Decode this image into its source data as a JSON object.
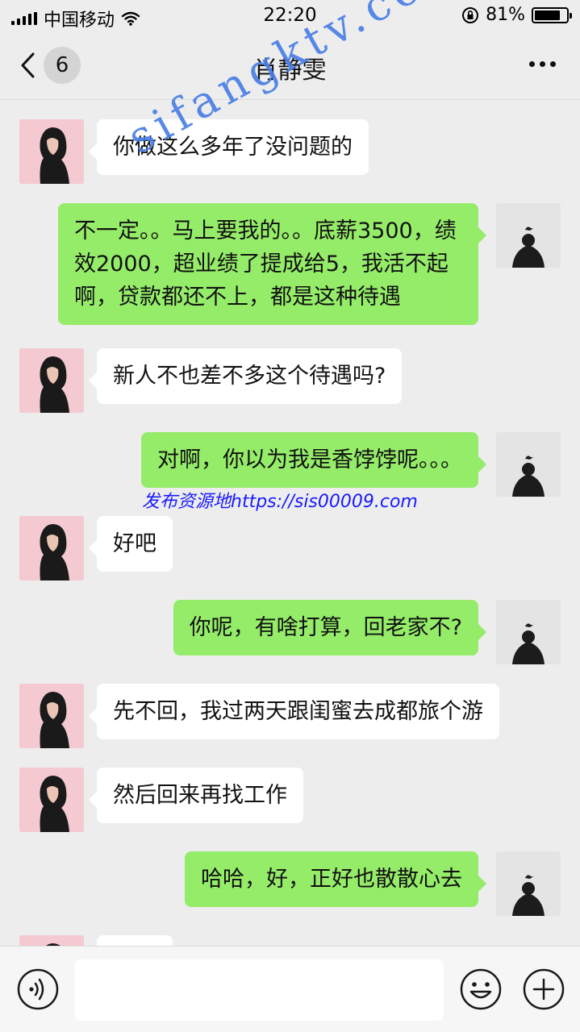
{
  "status_bar": {
    "carrier": "中国移动",
    "time": "22:20",
    "battery": "81%",
    "battery_level": 0.81
  },
  "nav": {
    "unread_count": "6",
    "title": "肖静雯"
  },
  "messages": [
    {
      "from": "her",
      "text": "你做这么多年了没问题的"
    },
    {
      "from": "me",
      "text": "不一定。。马上要我的。。底薪3500，绩效2000，超业绩了提成给5，我活不起啊，贷款都还不上，都是这种待遇"
    },
    {
      "from": "her",
      "text": "新人不也差不多这个待遇吗?"
    },
    {
      "from": "me",
      "text": "对啊，你以为我是香饽饽呢。。。"
    },
    {
      "from": "her",
      "text": "好吧"
    },
    {
      "from": "me",
      "text": "你呢，有啥打算，回老家不?"
    },
    {
      "from": "her",
      "text": "先不回，我过两天跟闺蜜去成都旅个游"
    },
    {
      "from": "her",
      "text": "然后回来再找工作"
    },
    {
      "from": "me",
      "text": "哈哈，好，正好也散散心去"
    }
  ],
  "watermarks": {
    "diagonal": "sifangktv.com",
    "link": "发布资源地https://sis00009.com"
  },
  "input_bar": {
    "placeholder": "",
    "icons": [
      "voice-icon",
      "emoji-icon",
      "plus-icon"
    ]
  },
  "icons": [
    "signal-icon",
    "wifi-icon",
    "lock-rotation-icon",
    "battery-icon",
    "back-chevron-icon",
    "more-dots-icon"
  ]
}
